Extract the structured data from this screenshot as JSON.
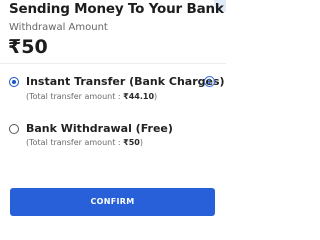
{
  "header": {
    "title": "Sending Money To Your Bank",
    "subtitle": "Withdrawal Amount",
    "amount": "₹50"
  },
  "options": [
    {
      "title": "Instant Transfer  (Bank Charges)",
      "sub_prefix": "(Total transfer amount : ",
      "sub_value": "₹44.10",
      "sub_suffix": ")",
      "selected": true,
      "icon": "info-icon"
    },
    {
      "title": "Bank Withdrawal (Free)",
      "sub_prefix": "(Total transfer amount : ",
      "sub_value": "₹50",
      "sub_suffix": ")",
      "selected": false
    }
  ],
  "confirm_label": "CONFIRM",
  "colors": {
    "accent": "#2760d8",
    "radio_selected": "#1a54c9",
    "info": "#3b78e7"
  }
}
